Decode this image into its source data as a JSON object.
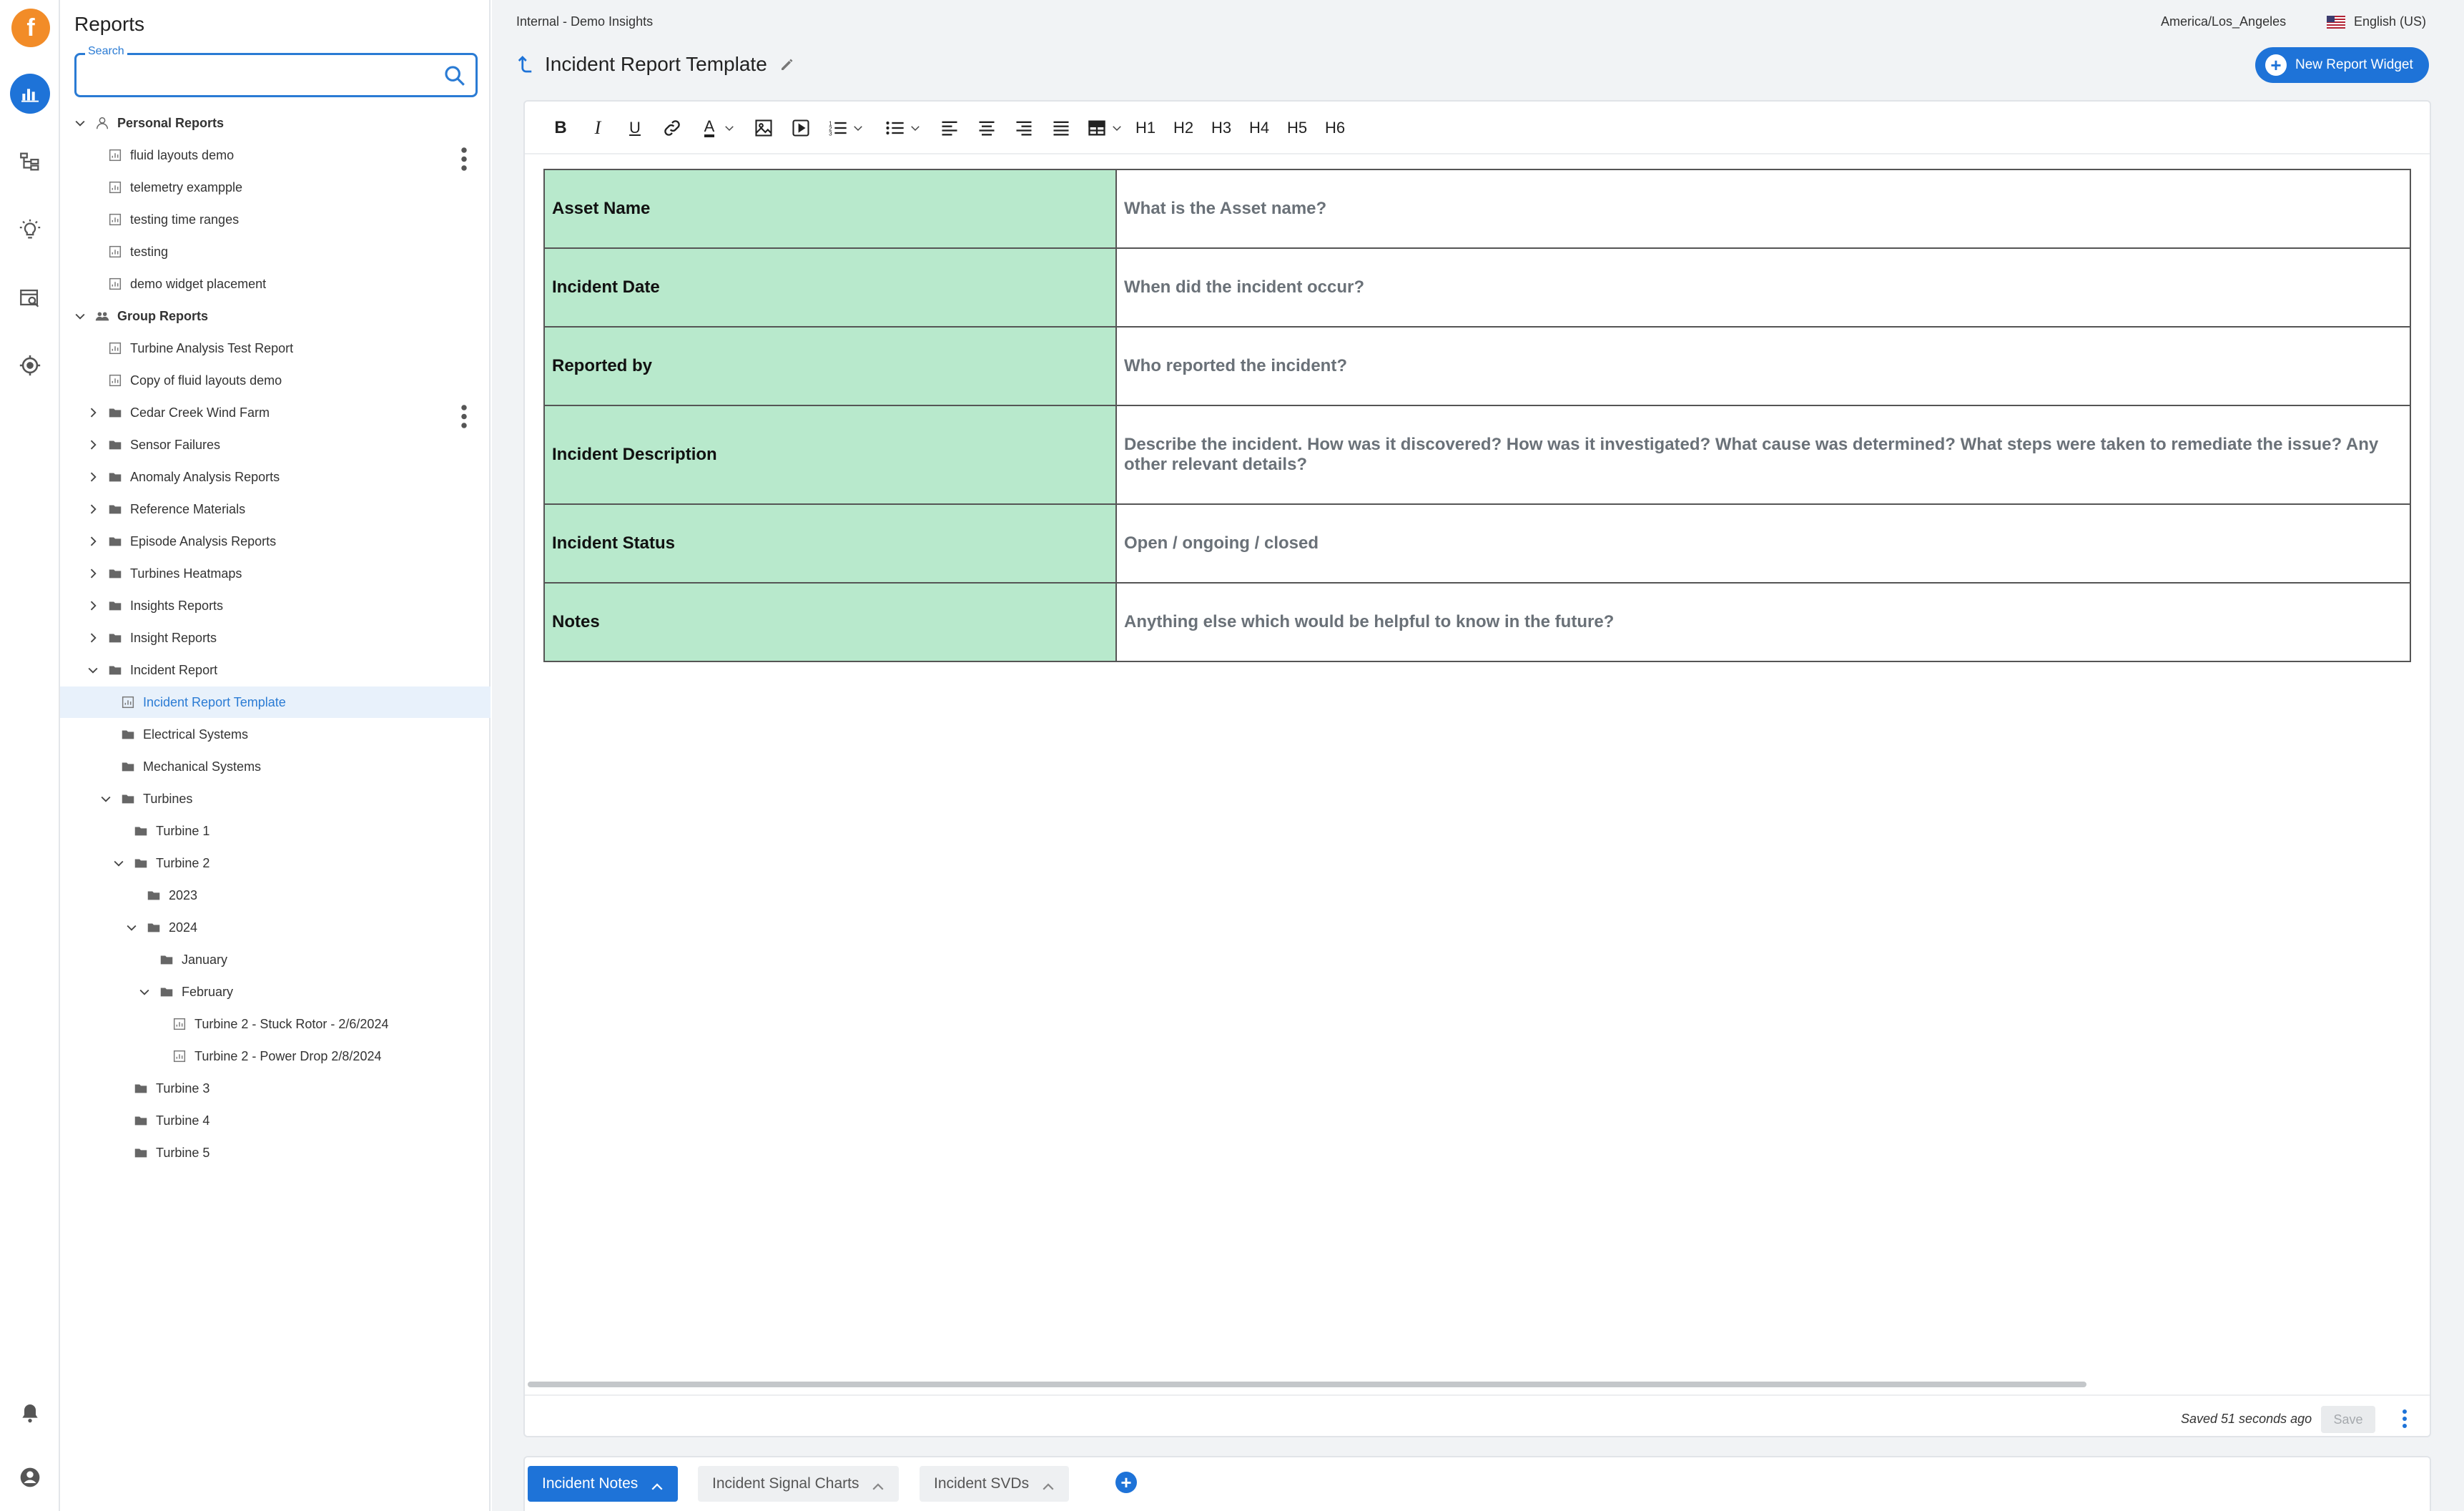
{
  "brand": {
    "logo_glyph": "f",
    "accent": "#1e73d8",
    "logo_color": "#f28c28"
  },
  "rail": {
    "icons": [
      "reports-icon",
      "hierarchy-icon",
      "insights-bulb-icon",
      "search-report-icon",
      "target-icon",
      "bell-icon",
      "user-account-icon"
    ]
  },
  "sidebar": {
    "title": "Reports",
    "search": {
      "label": "Search",
      "value": "",
      "placeholder": ""
    },
    "tree": [
      {
        "label": "Personal Reports",
        "type": "group-personal",
        "level": 0,
        "expanded": true,
        "bold": true
      },
      {
        "label": "fluid layouts demo",
        "type": "report",
        "level": 1,
        "more": true
      },
      {
        "label": "telemetry exampple",
        "type": "report",
        "level": 1
      },
      {
        "label": "testing time ranges",
        "type": "report",
        "level": 1
      },
      {
        "label": "testing",
        "type": "report",
        "level": 1
      },
      {
        "label": "demo widget placement",
        "type": "report",
        "level": 1
      },
      {
        "label": "Group Reports",
        "type": "group-shared",
        "level": 0,
        "expanded": true,
        "bold": true
      },
      {
        "label": "Turbine Analysis Test Report",
        "type": "report",
        "level": 1
      },
      {
        "label": "Copy of fluid layouts demo",
        "type": "report",
        "level": 1
      },
      {
        "label": "Cedar Creek Wind Farm",
        "type": "folder",
        "level": 1,
        "expanded": false,
        "more": true
      },
      {
        "label": "Sensor Failures",
        "type": "folder",
        "level": 1,
        "expanded": false
      },
      {
        "label": "Anomaly Analysis Reports",
        "type": "folder",
        "level": 1,
        "expanded": false
      },
      {
        "label": "Reference Materials",
        "type": "folder",
        "level": 1,
        "expanded": false
      },
      {
        "label": "Episode Analysis Reports",
        "type": "folder",
        "level": 1,
        "expanded": false
      },
      {
        "label": "Turbines Heatmaps",
        "type": "folder",
        "level": 1,
        "expanded": false
      },
      {
        "label": "Insights Reports",
        "type": "folder",
        "level": 1,
        "expanded": false
      },
      {
        "label": "Insight Reports",
        "type": "folder",
        "level": 1,
        "expanded": false
      },
      {
        "label": "Incident Report",
        "type": "folder",
        "level": 1,
        "expanded": true
      },
      {
        "label": "Incident Report Template",
        "type": "report",
        "level": 2,
        "selected": true
      },
      {
        "label": "Electrical Systems",
        "type": "folder",
        "level": 2
      },
      {
        "label": "Mechanical Systems",
        "type": "folder",
        "level": 2
      },
      {
        "label": "Turbines",
        "type": "folder",
        "level": 2,
        "expanded": true
      },
      {
        "label": "Turbine 1",
        "type": "folder",
        "level": 3
      },
      {
        "label": "Turbine 2",
        "type": "folder",
        "level": 3,
        "expanded": true
      },
      {
        "label": "2023",
        "type": "folder",
        "level": 4
      },
      {
        "label": "2024",
        "type": "folder",
        "level": 4,
        "expanded": true
      },
      {
        "label": "January",
        "type": "folder",
        "level": 5
      },
      {
        "label": "February",
        "type": "folder",
        "level": 5,
        "expanded": true
      },
      {
        "label": "Turbine 2 - Stuck Rotor - 2/6/2024",
        "type": "report",
        "level": 6
      },
      {
        "label": "Turbine 2 - Power Drop 2/8/2024",
        "type": "report",
        "level": 6
      },
      {
        "label": "Turbine 3",
        "type": "folder",
        "level": 3
      },
      {
        "label": "Turbine 4",
        "type": "folder",
        "level": 3
      },
      {
        "label": "Turbine 5",
        "type": "folder",
        "level": 3
      }
    ]
  },
  "header": {
    "org": "Internal - Demo Insights",
    "timezone": "America/Los_Angeles",
    "language": "English (US)",
    "title": "Incident Report Template",
    "new_widget_label": "New Report Widget"
  },
  "toolbar": {
    "items": [
      {
        "name": "bold-button",
        "glyph": "B"
      },
      {
        "name": "italic-button",
        "glyph": "I"
      },
      {
        "name": "underline-button",
        "glyph": "U"
      },
      {
        "name": "link-button",
        "glyph": "link"
      },
      {
        "name": "text-color-button",
        "glyph": "A"
      },
      {
        "name": "insert-image-button",
        "glyph": "image"
      },
      {
        "name": "insert-video-button",
        "glyph": "video"
      },
      {
        "name": "ordered-list-button",
        "glyph": "ol"
      },
      {
        "name": "bullet-list-button",
        "glyph": "ul"
      },
      {
        "name": "align-left-button",
        "glyph": "al"
      },
      {
        "name": "align-center-button",
        "glyph": "ac"
      },
      {
        "name": "align-right-button",
        "glyph": "ar"
      },
      {
        "name": "justify-button",
        "glyph": "aj"
      },
      {
        "name": "table-button",
        "glyph": "table"
      }
    ],
    "headings": [
      "H1",
      "H2",
      "H3",
      "H4",
      "H5",
      "H6"
    ]
  },
  "document": {
    "rows": [
      {
        "key": "Asset Name",
        "value": "What is the Asset name?"
      },
      {
        "key": "Incident Date",
        "value": "When did the incident occur?"
      },
      {
        "key": "Reported by",
        "value": "Who reported the incident?"
      },
      {
        "key": "Incident Description",
        "value": "Describe the incident. How was it discovered? How was it investigated? What cause was determined? What steps were taken to remediate the issue? Any other relevant details?"
      },
      {
        "key": "Incident Status",
        "value": "Open / ongoing / closed"
      },
      {
        "key": "Notes",
        "value": "Anything else which would be helpful to know in the future?"
      }
    ]
  },
  "footer": {
    "saved_text": "Saved 51 seconds ago",
    "save_label": "Save"
  },
  "tabs": [
    {
      "label": "Incident Notes",
      "active": true
    },
    {
      "label": "Incident Signal Charts",
      "active": false
    },
    {
      "label": "Incident SVDs",
      "active": false
    }
  ]
}
